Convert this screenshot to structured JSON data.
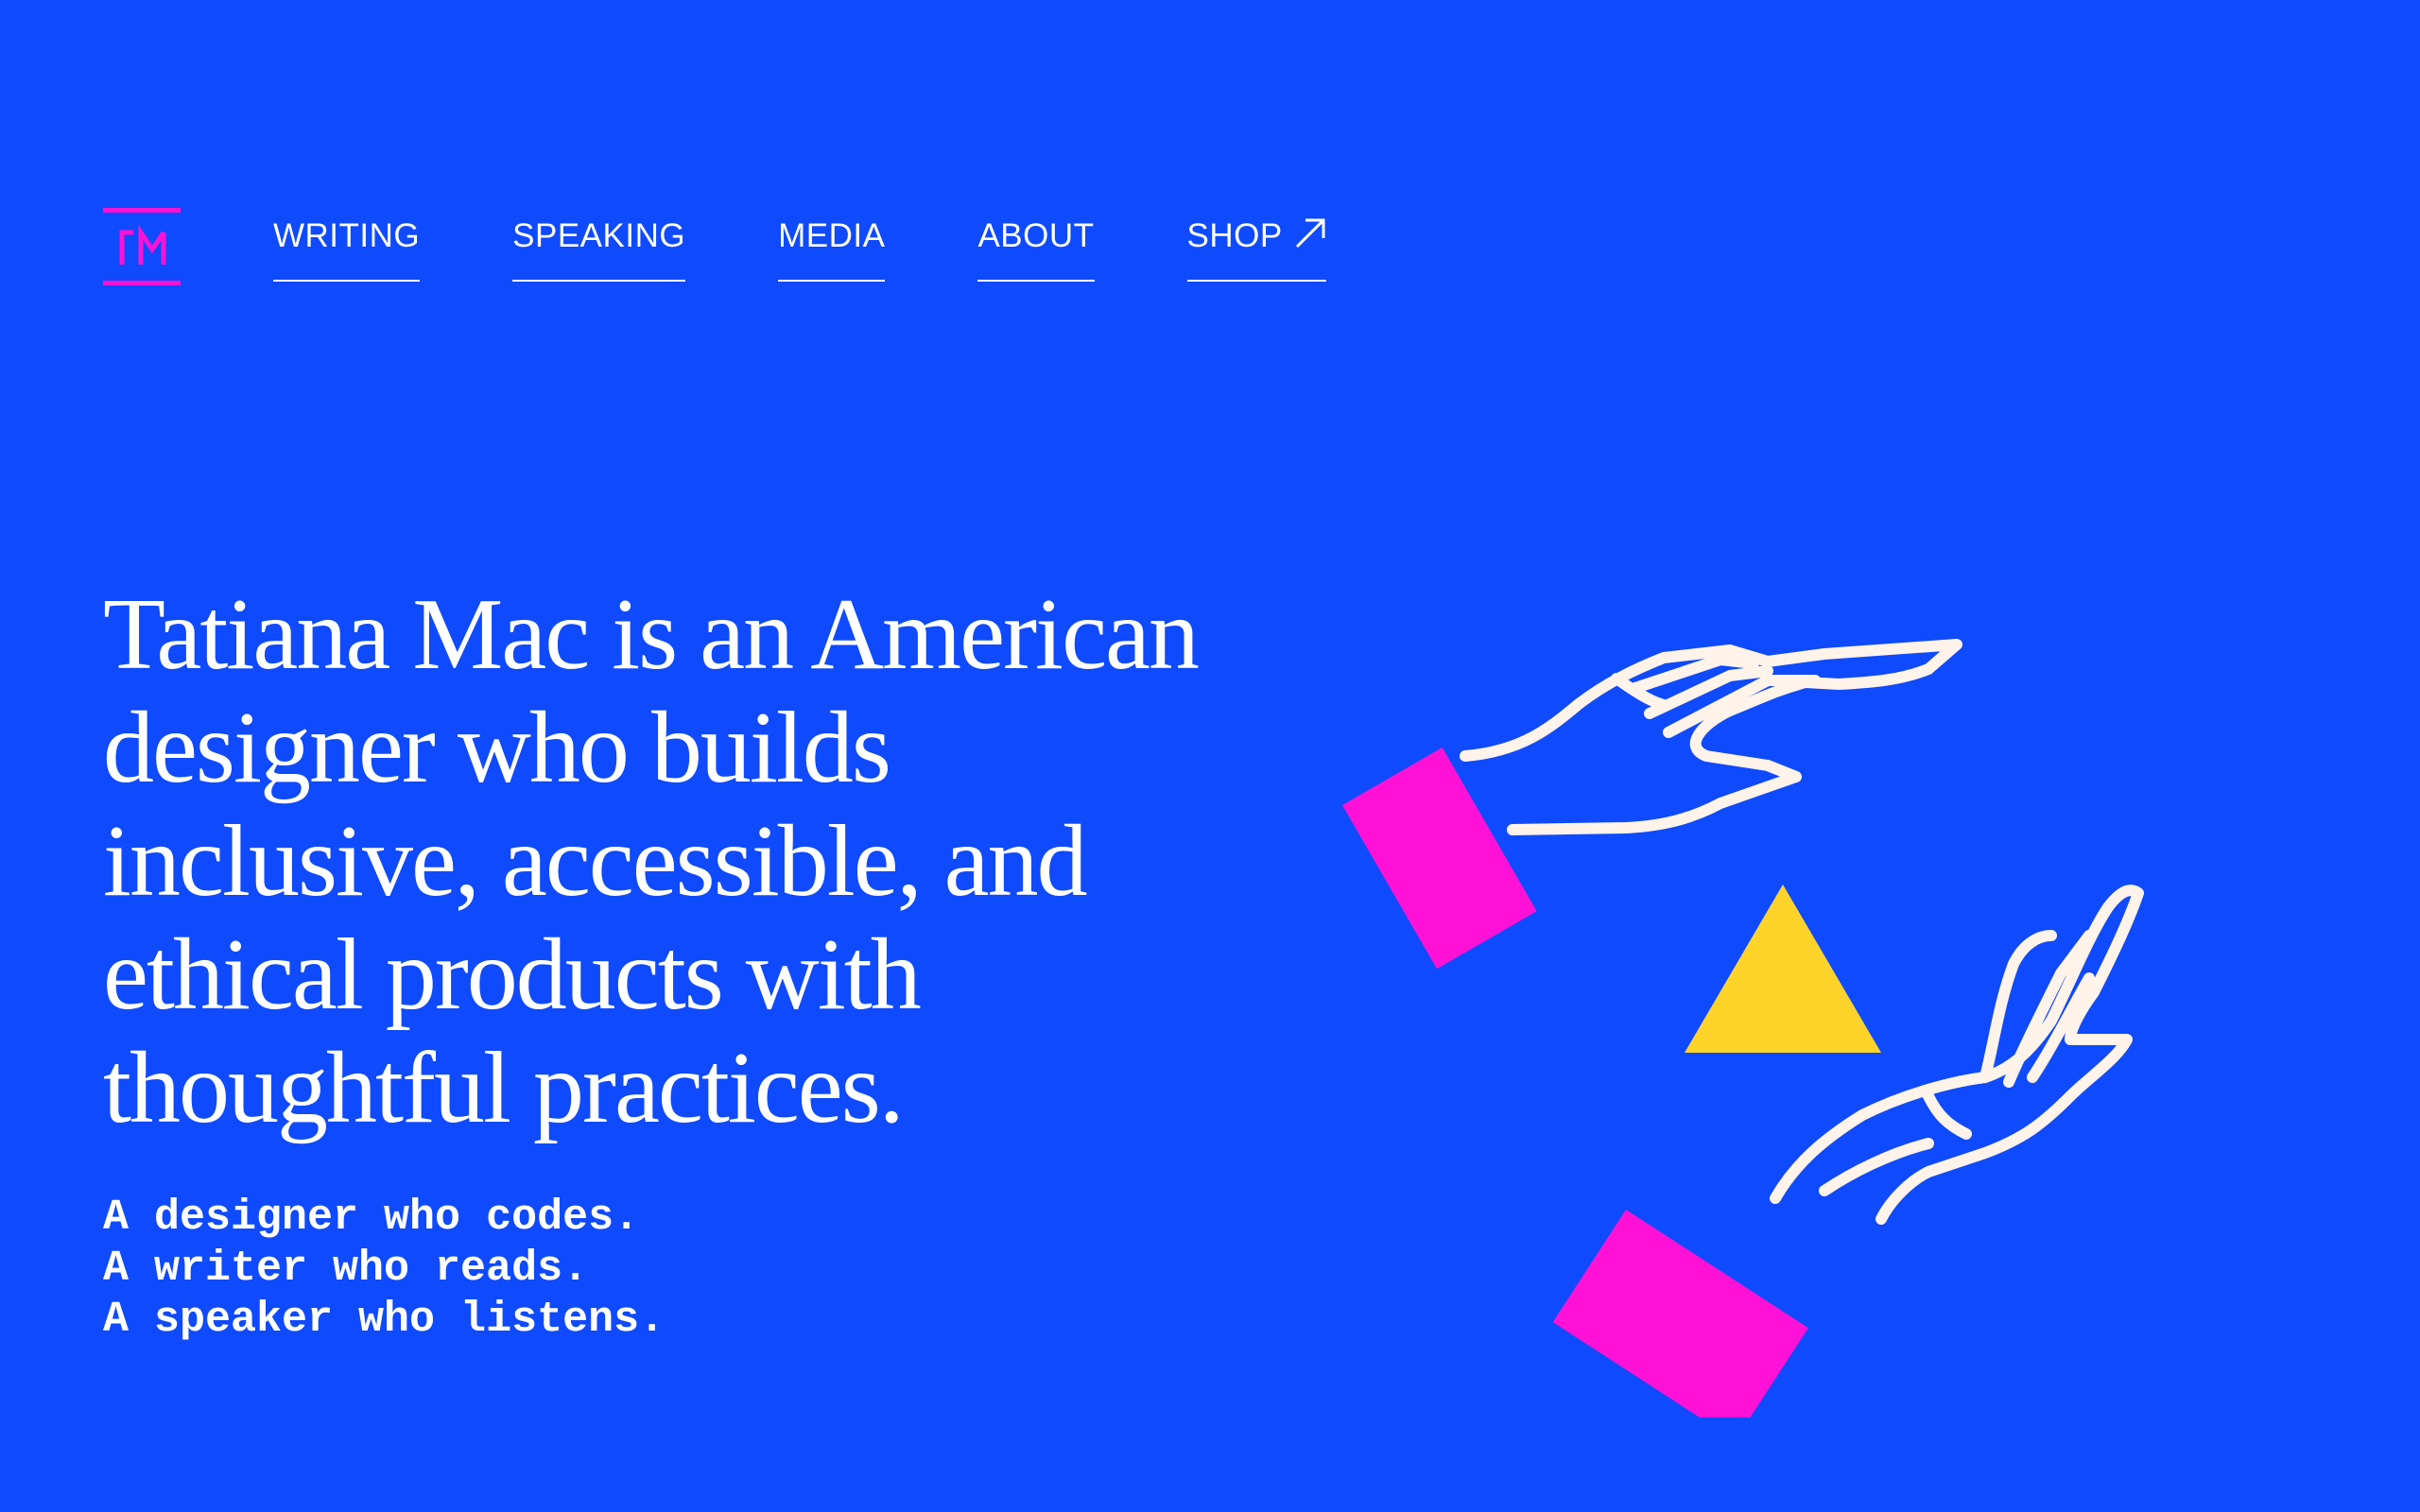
{
  "nav": {
    "items": [
      {
        "label": "WRITING"
      },
      {
        "label": "SPEAKING"
      },
      {
        "label": "MEDIA"
      },
      {
        "label": "ABOUT"
      },
      {
        "label": "SHOP",
        "icon": "external-arrow-icon"
      }
    ]
  },
  "hero": {
    "headline": "Tatiana Mac is an American designer who builds inclusive, accessible, and ethical products with thoughtful practices.",
    "tagline": [
      "A designer who codes.",
      "A writer who reads.",
      "A speaker who listens."
    ]
  },
  "colors": {
    "background": "#0f4afc",
    "text": "#ffffff",
    "accent_magenta": "#ff12d6",
    "accent_yellow": "#ffd42a",
    "line_cream": "#fff3ea"
  }
}
